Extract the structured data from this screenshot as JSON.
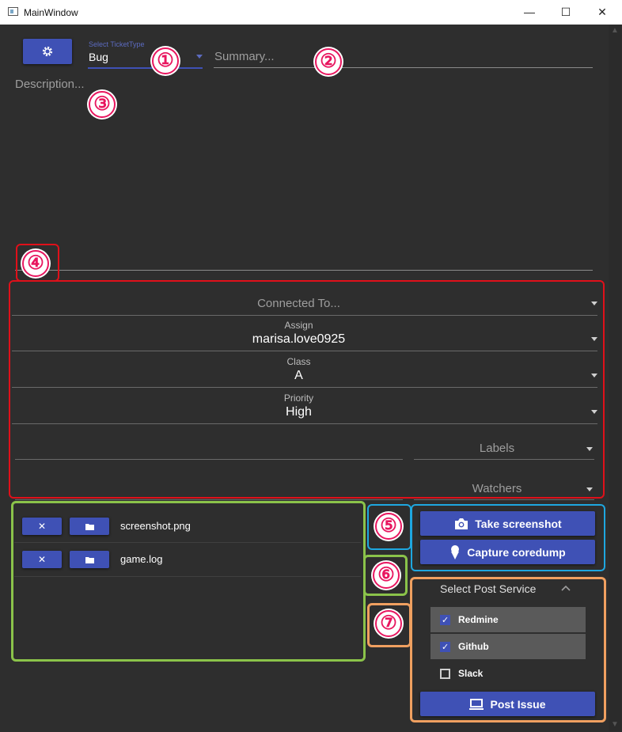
{
  "window": {
    "title": "MainWindow",
    "minimize": "—",
    "maximize": "☐",
    "close": "✕"
  },
  "top": {
    "settings_icon": "gear-icon",
    "ticket_type_label": "Select TicketType",
    "ticket_type_value": "Bug",
    "summary_placeholder": "Summary...",
    "description_placeholder": "Description..."
  },
  "fields": {
    "connected_to_placeholder": "Connected To...",
    "assign_label": "Assign",
    "assign_value": "marisa.love0925",
    "class_label": "Class",
    "class_value": "A",
    "priority_label": "Priority",
    "priority_value": "High",
    "labels_placeholder": "Labels",
    "watchers_placeholder": "Watchers"
  },
  "attachments": {
    "items": [
      {
        "remove": "✕",
        "open_icon": "folder-icon",
        "name": "screenshot.png"
      },
      {
        "remove": "✕",
        "open_icon": "folder-icon",
        "name": "game.log"
      }
    ]
  },
  "actions": {
    "take_screenshot": "Take screenshot",
    "capture_coredump": "Capture coredump"
  },
  "post_service": {
    "header": "Select Post Service",
    "expand_icon": "chevron-up-icon",
    "services": [
      {
        "name": "Redmine",
        "checked": true
      },
      {
        "name": "Github",
        "checked": true
      },
      {
        "name": "Slack",
        "checked": false
      }
    ],
    "post_issue": "Post Issue"
  },
  "annotations": {
    "b1": "①",
    "b2": "②",
    "b3": "③",
    "b4": "④",
    "b5": "⑤",
    "b6": "⑥",
    "b7": "⑦"
  },
  "colors": {
    "accent": "#3f51b5",
    "background": "#2e2e2e",
    "annot_red": "#e0101a",
    "annot_green": "#8bc34a",
    "annot_blue": "#1ea7e0",
    "annot_orange": "#f0a060",
    "badge": "#e8165f"
  }
}
